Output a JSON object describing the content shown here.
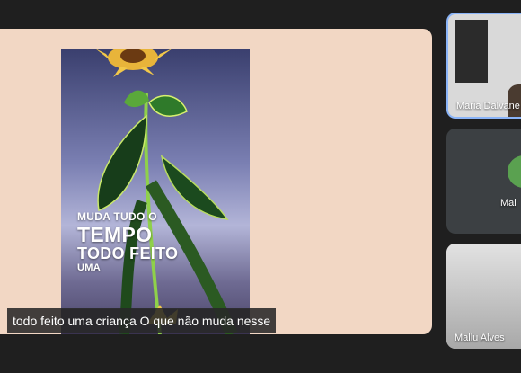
{
  "presentation": {
    "poster_lines": [
      "MUDA TUDO O",
      "TEMPO",
      "TODO FEITO",
      "UMA"
    ],
    "caption": "todo feito uma criança O que não muda nesse",
    "background_color": "#f2d7c4"
  },
  "participants": [
    {
      "name": "Maria Dalvane",
      "active_speaker": true
    },
    {
      "name": "Mai",
      "video": false,
      "avatar_color": "#5aa150"
    },
    {
      "name": "Mallu Alves"
    }
  ]
}
